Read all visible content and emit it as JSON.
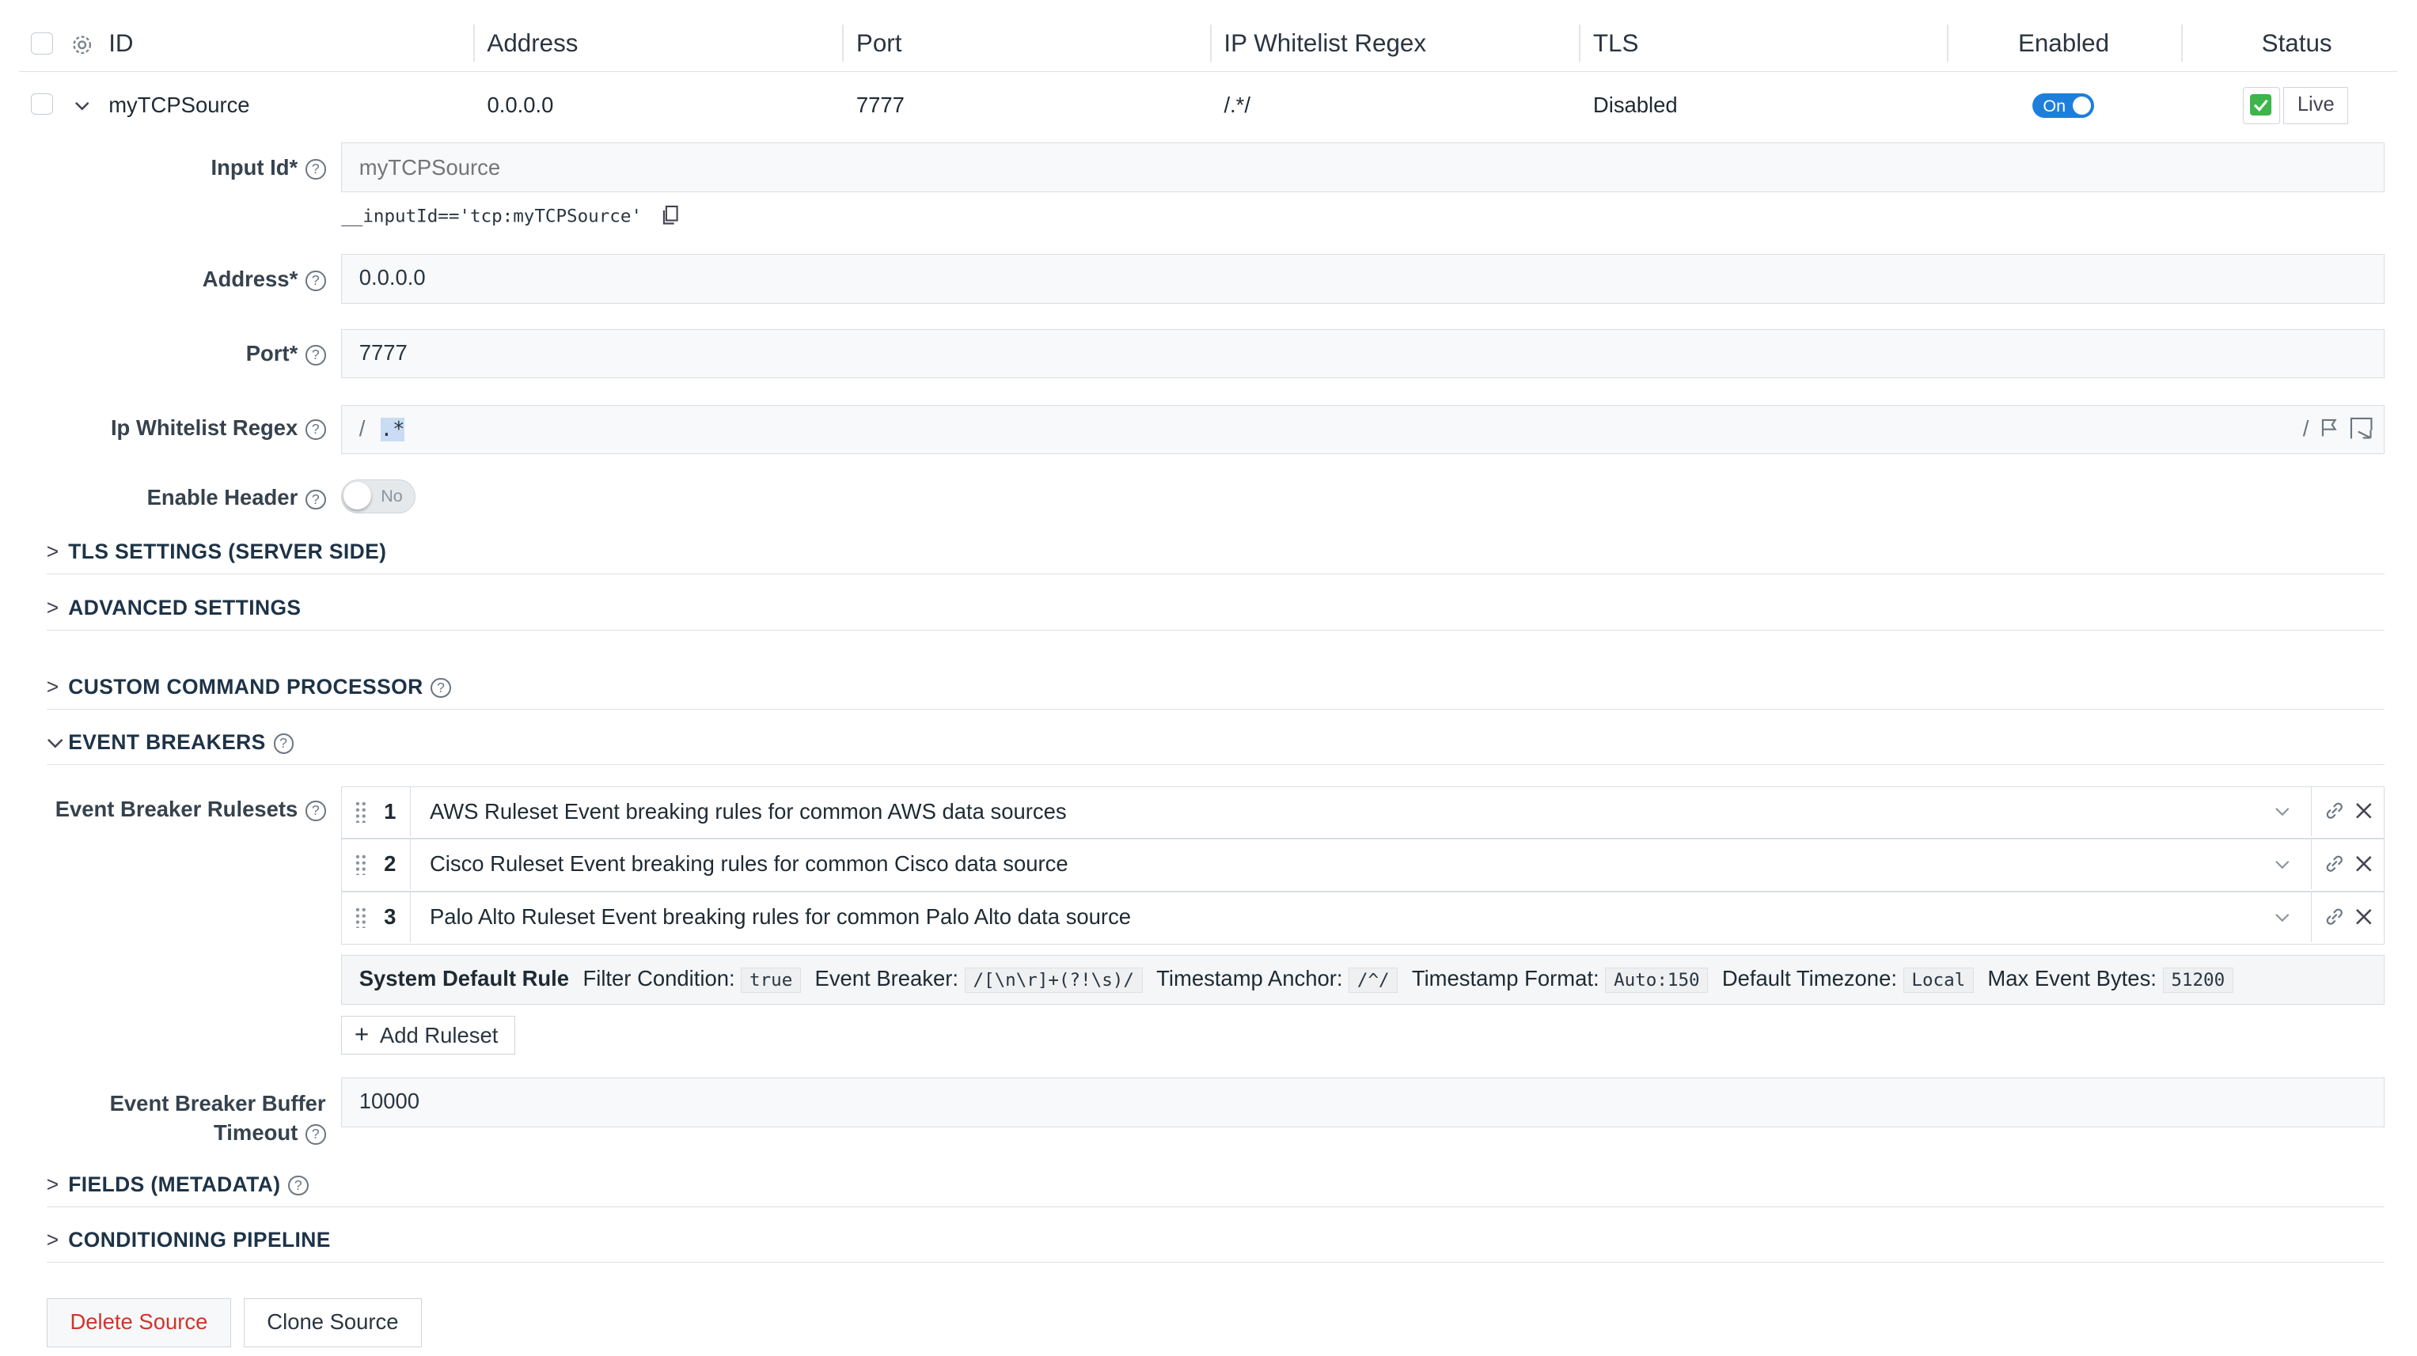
{
  "table": {
    "headers": [
      "ID",
      "Address",
      "Port",
      "IP Whitelist Regex",
      "TLS",
      "Enabled",
      "Status"
    ],
    "row": {
      "id": "myTCPSource",
      "address": "0.0.0.0",
      "port": "7777",
      "ip_regex": "/.*/",
      "tls": "Disabled",
      "enabled_label": "On",
      "status_label": "Live"
    }
  },
  "form": {
    "input_id": {
      "label": "Input Id*",
      "placeholder": "myTCPSource",
      "hint": "__inputId=='tcp:myTCPSource'"
    },
    "address": {
      "label": "Address*",
      "value": "0.0.0.0"
    },
    "port": {
      "label": "Port*",
      "value": "7777"
    },
    "ip_whitelist": {
      "label": "Ip Whitelist Regex",
      "open_slash": "/",
      "value": ".*",
      "close_slash": "/"
    },
    "enable_header": {
      "label": "Enable Header",
      "toggle_label": "No"
    }
  },
  "sections": {
    "tls": "TLS SETTINGS (SERVER SIDE)",
    "advanced": "ADVANCED SETTINGS",
    "custom_cmd": "CUSTOM COMMAND PROCESSOR",
    "event_breakers": "EVENT BREAKERS",
    "fields": "FIELDS (METADATA)",
    "pipeline": "CONDITIONING PIPELINE"
  },
  "event_breakers": {
    "rulesets_label": "Event Breaker Rulesets",
    "rulesets": [
      {
        "num": "1",
        "text": "AWS Ruleset Event breaking rules for common AWS data sources"
      },
      {
        "num": "2",
        "text": "Cisco Ruleset Event breaking rules for common Cisco data source"
      },
      {
        "num": "3",
        "text": "Palo Alto Ruleset Event breaking rules for common Palo Alto data source"
      }
    ],
    "system_default": {
      "title": "System Default Rule",
      "filter_label": "Filter Condition:",
      "filter_value": "true",
      "breaker_label": "Event Breaker:",
      "breaker_value": "/[\\n\\r]+(?!\\s)/",
      "anchor_label": "Timestamp Anchor:",
      "anchor_value": "/^/",
      "format_label": "Timestamp Format:",
      "format_value": "Auto:150",
      "tz_label": "Default Timezone:",
      "tz_value": "Local",
      "max_label": "Max Event Bytes:",
      "max_value": "51200"
    },
    "add_ruleset": "Add Ruleset",
    "buffer_label_1": "Event Breaker Buffer",
    "buffer_label_2": "Timeout",
    "buffer_value": "10000"
  },
  "buttons": {
    "delete": "Delete Source",
    "clone": "Clone Source"
  },
  "colors": {
    "accent": "#1d7fdb",
    "live_green": "#3cb54a",
    "danger": "#d0342c"
  }
}
